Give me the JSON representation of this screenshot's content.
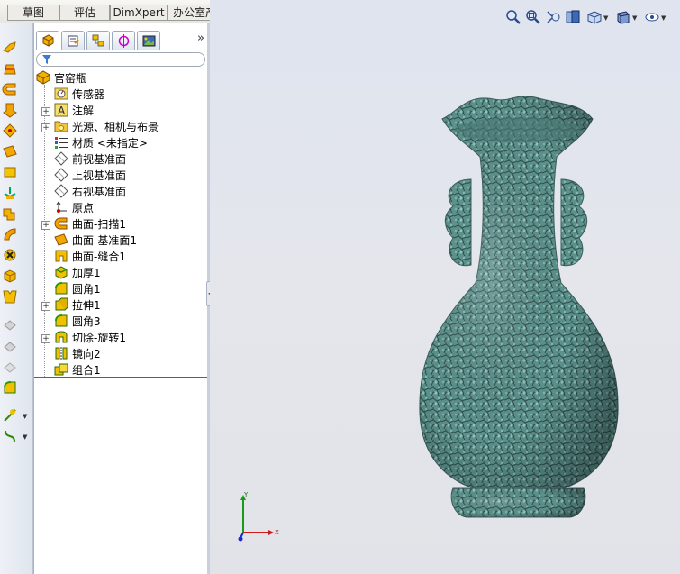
{
  "tabs": [
    "草图",
    "评估",
    "DimXpert",
    "办公室产品"
  ],
  "toolbar_icons": [
    "swept-surface-icon",
    "lofted-surface-icon",
    "boundary-surface-icon",
    "extruded-surface-icon",
    "revolved-surface-icon",
    "planar-surface-icon",
    "offset-surface-icon",
    "knit-surface-icon",
    "fillet-surface-icon",
    "delete-face-icon",
    "cut-with-surface-icon",
    "thicken-icon",
    "fill-surface-icon",
    "untrim-surface-icon",
    "extend-surface-icon",
    "fillet-icon",
    "reference-geometry-icon",
    "curves-icon"
  ],
  "feature_manager": {
    "tabs": [
      "feature-tree-tab",
      "property-manager-tab",
      "configuration-manager-tab",
      "dimxpert-manager-tab",
      "display-manager-tab"
    ],
    "more_label": "»",
    "filter_placeholder": "",
    "root": "官窑瓶",
    "items": [
      {
        "label": "传感器",
        "icon": "sensors-icon",
        "expandable": false
      },
      {
        "label": "注解",
        "icon": "annotations-icon",
        "expandable": true
      },
      {
        "label": "光源、相机与布景",
        "icon": "lights-cameras-icon",
        "expandable": true
      },
      {
        "label": "材质 <未指定>",
        "icon": "material-icon",
        "expandable": false
      },
      {
        "label": "前视基准面",
        "icon": "plane-icon",
        "expandable": false
      },
      {
        "label": "上视基准面",
        "icon": "plane-icon",
        "expandable": false
      },
      {
        "label": "右视基准面",
        "icon": "plane-icon",
        "expandable": false
      },
      {
        "label": "原点",
        "icon": "origin-icon",
        "expandable": false
      },
      {
        "label": "曲面-扫描1",
        "icon": "swept-surface-icon",
        "expandable": true
      },
      {
        "label": "曲面-基准面1",
        "icon": "planar-surface-icon",
        "expandable": false
      },
      {
        "label": "曲面-缝合1",
        "icon": "knit-surface-icon",
        "expandable": false
      },
      {
        "label": "加厚1",
        "icon": "thicken-icon",
        "expandable": false
      },
      {
        "label": "圆角1",
        "icon": "fillet-icon",
        "expandable": false
      },
      {
        "label": "拉伸1",
        "icon": "extrude-icon",
        "expandable": true
      },
      {
        "label": "圆角3",
        "icon": "fillet-icon",
        "expandable": false
      },
      {
        "label": "切除-旋转1",
        "icon": "cut-revolve-icon",
        "expandable": true
      },
      {
        "label": "镜向2",
        "icon": "mirror-icon",
        "expandable": false
      },
      {
        "label": "组合1",
        "icon": "combine-icon",
        "expandable": false
      }
    ]
  },
  "viewport": {
    "hud_icons": [
      "zoom-to-fit-icon",
      "zoom-to-area-icon",
      "previous-view-icon",
      "section-view-icon",
      "view-orientation-icon",
      "display-style-icon",
      "hide-show-items-icon"
    ],
    "triad_labels": {
      "x": "X",
      "y": "Y"
    },
    "model_color": "#5e8f8b"
  }
}
